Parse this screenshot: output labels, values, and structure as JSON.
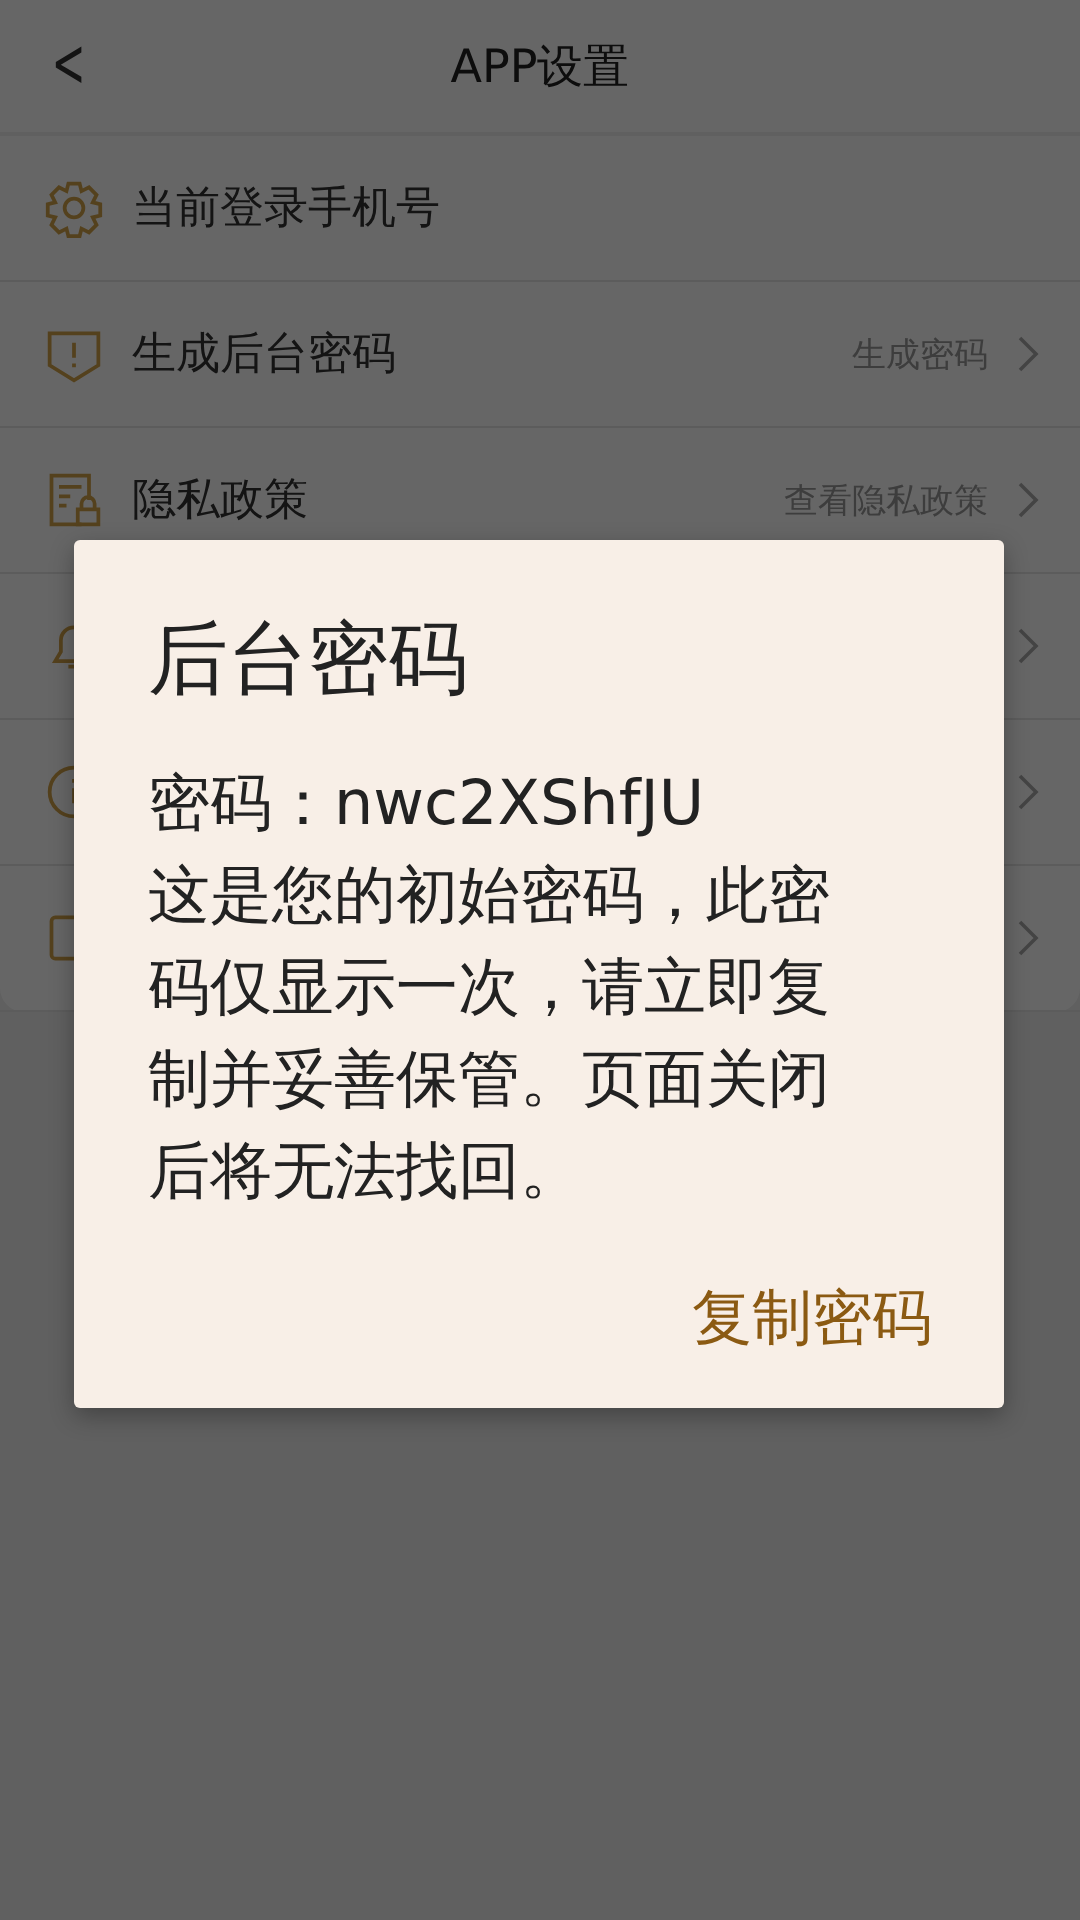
{
  "header": {
    "back_icon": "<",
    "title": "APP设置"
  },
  "rows": [
    {
      "kind": "gear",
      "label": "当前登录手机号",
      "chevron": false
    },
    {
      "kind": "shield",
      "label": "生成后台密码",
      "value": "生成密码",
      "chevron": true
    },
    {
      "kind": "document",
      "label": "隐私政策",
      "value": "查看隐私政策",
      "chevron": true
    },
    {
      "kind": "bell",
      "chevron": true
    },
    {
      "kind": "info",
      "chevron": true
    },
    {
      "kind": "square",
      "chevron": true
    }
  ],
  "dialog": {
    "title": "后台密码",
    "password_line": "密码：nwc2XShfJU",
    "message": "这是您的初始密码，此密码仅显示一次，请立即复制并妥善保管。页面关闭后将无法找回。",
    "button": "复制密码"
  }
}
